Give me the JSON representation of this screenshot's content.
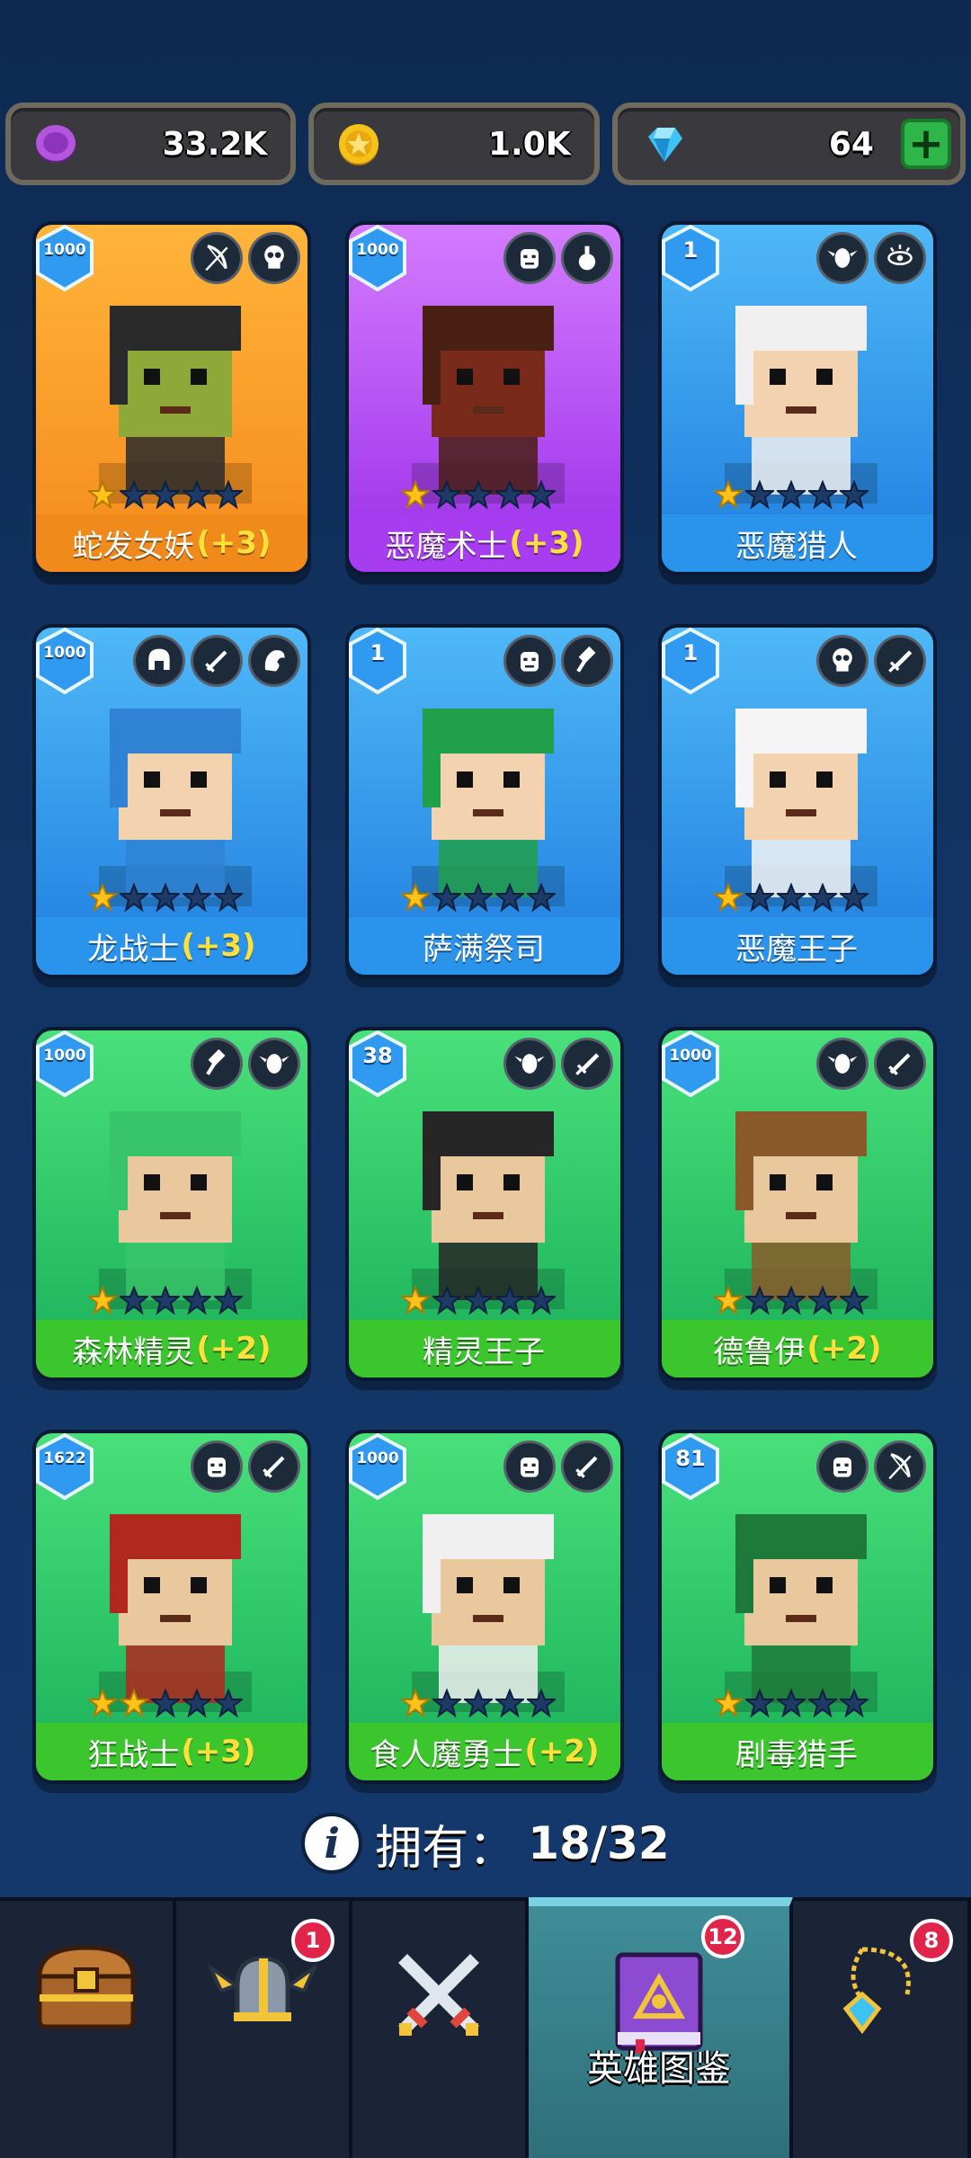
{
  "resources": [
    {
      "name": "purple-coin",
      "value": "33.2K",
      "color": "#b455e0"
    },
    {
      "name": "gold-coin",
      "value": "1.0K",
      "color": "#f5c21a"
    },
    {
      "name": "gem",
      "value": "64",
      "color": "#3fc3f5"
    }
  ],
  "heroes": [
    {
      "name": "蛇发女妖",
      "bonus": "(+3)",
      "level": "1000",
      "stars": 1,
      "rarity": "orange",
      "classes": [
        "bow-icon",
        "skull-icon"
      ]
    },
    {
      "name": "恶魔术士",
      "bonus": "(+3)",
      "level": "1000",
      "stars": 1,
      "rarity": "purple",
      "classes": [
        "orc-icon",
        "potion-icon"
      ]
    },
    {
      "name": "恶魔猎人",
      "bonus": "",
      "level": "1",
      "stars": 1,
      "rarity": "blue",
      "classes": [
        "elf-icon",
        "eye-icon"
      ]
    },
    {
      "name": "龙战士",
      "bonus": "(+3)",
      "level": "1000",
      "stars": 1,
      "rarity": "blue",
      "classes": [
        "helmet-icon",
        "sword-icon",
        "dragon-icon"
      ]
    },
    {
      "name": "萨满祭司",
      "bonus": "",
      "level": "1",
      "stars": 1,
      "rarity": "blue",
      "classes": [
        "orc-icon",
        "hammer-icon"
      ]
    },
    {
      "name": "恶魔王子",
      "bonus": "",
      "level": "1",
      "stars": 1,
      "rarity": "blue",
      "classes": [
        "skull-icon",
        "dagger-icon"
      ]
    },
    {
      "name": "森林精灵",
      "bonus": "(+2)",
      "level": "1000",
      "stars": 1,
      "rarity": "green",
      "classes": [
        "hammer-icon",
        "elf-icon"
      ]
    },
    {
      "name": "精灵王子",
      "bonus": "",
      "level": "38",
      "stars": 1,
      "rarity": "green",
      "classes": [
        "elf-icon",
        "dagger-icon"
      ]
    },
    {
      "name": "德鲁伊",
      "bonus": "(+2)",
      "level": "1000",
      "stars": 1,
      "rarity": "green",
      "classes": [
        "elf-icon",
        "sword-icon"
      ]
    },
    {
      "name": "狂战士",
      "bonus": "(+3)",
      "level": "1622",
      "stars": 2,
      "rarity": "green",
      "classes": [
        "orc-icon",
        "sword-icon"
      ]
    },
    {
      "name": "食人魔勇士",
      "bonus": "(+2)",
      "level": "1000",
      "stars": 1,
      "rarity": "green",
      "classes": [
        "orc-icon",
        "sword-icon"
      ]
    },
    {
      "name": "剧毒猎手",
      "bonus": "",
      "level": "81",
      "stars": 1,
      "rarity": "green",
      "classes": [
        "orc-icon",
        "bow-icon"
      ]
    }
  ],
  "owned": {
    "label": "拥有：",
    "count": "18/32"
  },
  "nav": [
    {
      "icon": "treasure-chest-icon",
      "label": "",
      "badge": ""
    },
    {
      "icon": "winged-helmet-icon",
      "label": "",
      "badge": "1"
    },
    {
      "icon": "crossed-swords-icon",
      "label": "",
      "badge": ""
    },
    {
      "icon": "spellbook-icon",
      "label": "英雄图鉴",
      "badge": "12",
      "active": true
    },
    {
      "icon": "amulet-icon",
      "label": "",
      "badge": "8"
    }
  ]
}
